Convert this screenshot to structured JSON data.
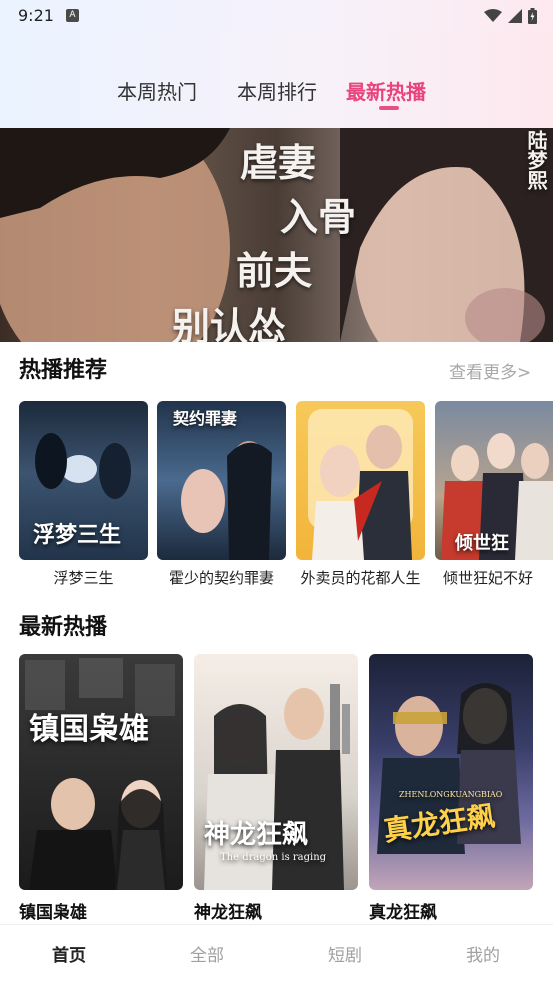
{
  "status": {
    "time": "9:21",
    "badge": "A"
  },
  "tabs": [
    {
      "label": "本周热门"
    },
    {
      "label": "本周排行"
    },
    {
      "label": "最新热播"
    }
  ],
  "banner": {
    "title_lines": [
      "虐妻",
      "入骨",
      "前夫",
      "别认怂"
    ],
    "credit": "陆梦熙"
  },
  "hot_section": {
    "title": "热播推荐",
    "more": "查看更多>",
    "items": [
      {
        "label": "浮梦三生",
        "poster_text": "浮梦三生"
      },
      {
        "label": "霍少的契约罪妻",
        "poster_text": "契约罪妻"
      },
      {
        "label": "外卖员的花都人生",
        "poster_text": ""
      },
      {
        "label": "倾世狂妃不好",
        "poster_text": "倾世狂"
      }
    ]
  },
  "new_section": {
    "title": "最新热播",
    "items": [
      {
        "label": "镇国枭雄",
        "poster_text": "镇国枭雄"
      },
      {
        "label": "神龙狂飙",
        "poster_text": "神龙狂飙",
        "poster_sub": "The dragon is raging"
      },
      {
        "label": "真龙狂飙",
        "poster_text": "真龙狂飙",
        "poster_sub": "ZHENLONGKUANGBIAO"
      }
    ]
  },
  "bottom_nav": [
    {
      "label": "首页"
    },
    {
      "label": "全部"
    },
    {
      "label": "短剧"
    },
    {
      "label": "我的"
    }
  ],
  "colors": {
    "accent": "#e9457c"
  }
}
